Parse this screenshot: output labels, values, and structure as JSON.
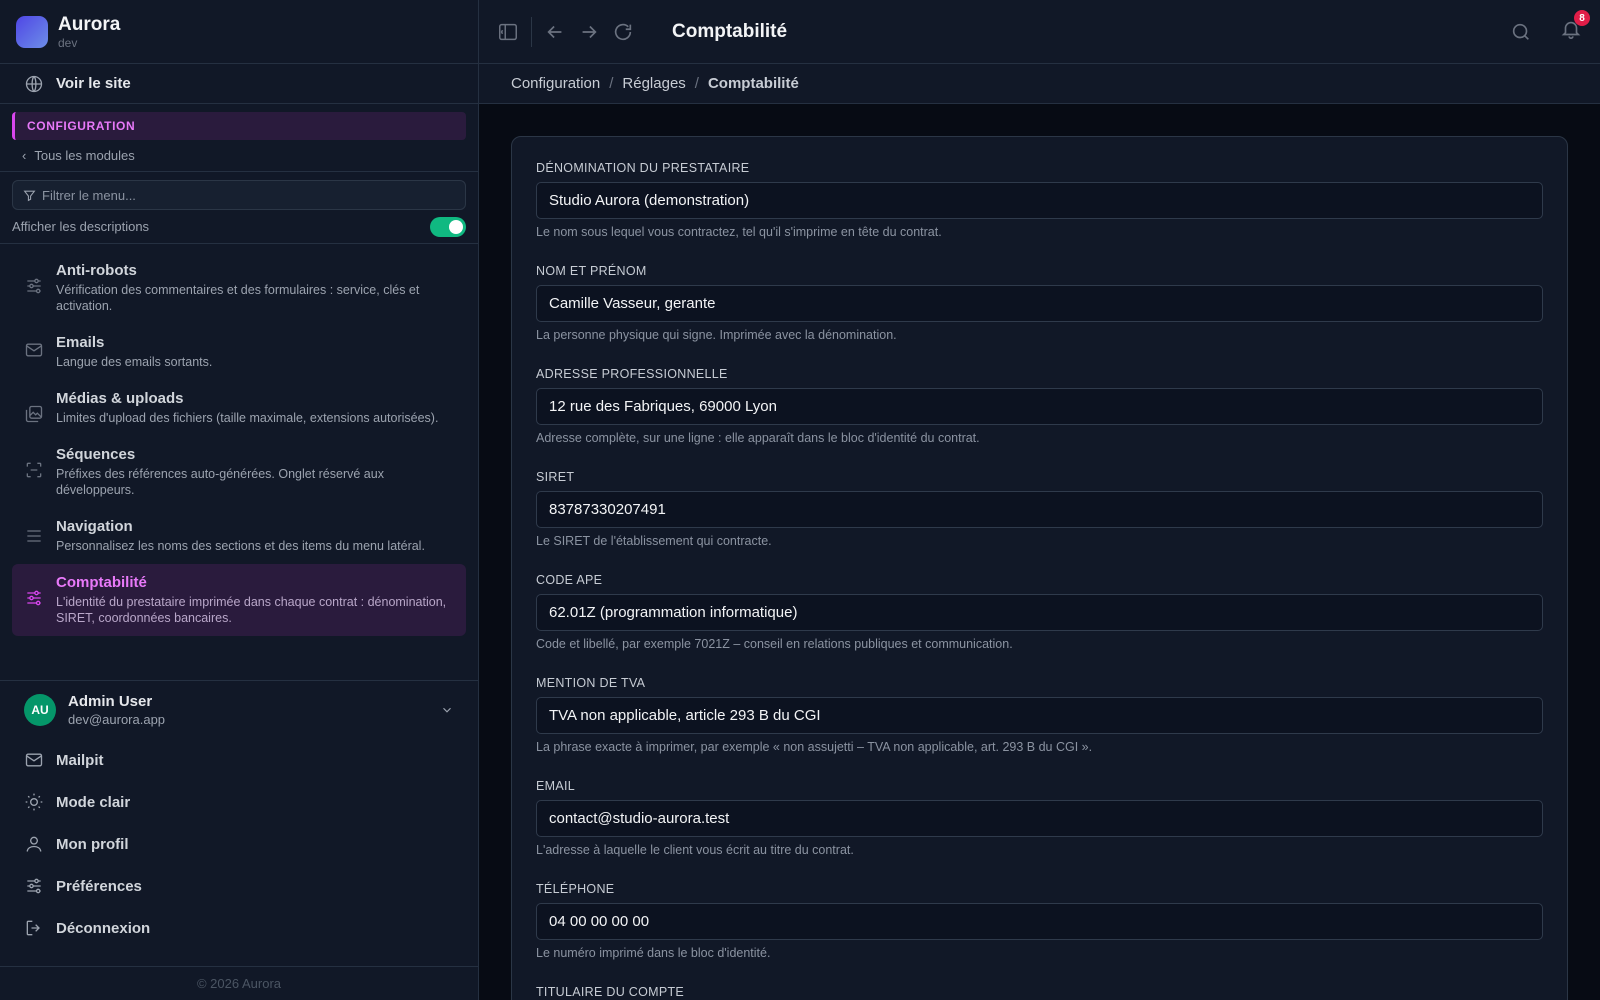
{
  "brand": {
    "name": "Aurora",
    "env": "dev"
  },
  "sidebar": {
    "site_link": "Voir le site",
    "section": "CONFIGURATION",
    "back": "Tous les modules",
    "filter_placeholder": "Filtrer le menu...",
    "toggle_label": "Afficher les descriptions",
    "toggle_on": true,
    "modules": [
      {
        "title": "Anti-robots",
        "desc": "Vérification des commentaires et des formulaires : service, clés et activation.",
        "icon": "sliders-icon"
      },
      {
        "title": "Emails",
        "desc": "Langue des emails sortants.",
        "icon": "mail-icon"
      },
      {
        "title": "Médias & uploads",
        "desc": "Limites d'upload des fichiers (taille maximale, extensions autorisées).",
        "icon": "images-icon"
      },
      {
        "title": "Séquences",
        "desc": "Préfixes des références auto-générées. Onglet réservé aux développeurs.",
        "icon": "scan-icon"
      },
      {
        "title": "Navigation",
        "desc": "Personnalisez les noms des sections et des items du menu latéral.",
        "icon": "list-icon"
      },
      {
        "title": "Comptabilité",
        "desc": "L'identité du prestataire imprimée dans chaque contrat : dénomination, SIRET, coordonnées bancaires.",
        "icon": "sliders-icon",
        "active": true
      }
    ],
    "user": {
      "initials": "AU",
      "name": "Admin User",
      "email": "dev@aurora.app"
    },
    "menu": [
      "Mailpit",
      "Mode clair",
      "Mon profil",
      "Préférences",
      "Déconnexion"
    ],
    "copyright": "© 2026 Aurora"
  },
  "topbar": {
    "title": "Comptabilité",
    "notifications": "8"
  },
  "breadcrumb": [
    "Configuration",
    "Réglages",
    "Comptabilité"
  ],
  "form": {
    "fields": [
      {
        "label": "DÉNOMINATION DU PRESTATAIRE",
        "value": "Studio Aurora (demonstration)",
        "help": "Le nom sous lequel vous contractez, tel qu'il s'imprime en tête du contrat."
      },
      {
        "label": "NOM ET PRÉNOM",
        "value": "Camille Vasseur, gerante",
        "help": "La personne physique qui signe. Imprimée avec la dénomination."
      },
      {
        "label": "ADRESSE PROFESSIONNELLE",
        "value": "12 rue des Fabriques, 69000 Lyon",
        "help": "Adresse complète, sur une ligne : elle apparaît dans le bloc d'identité du contrat."
      },
      {
        "label": "SIRET",
        "value": "83787330207491",
        "help": "Le SIRET de l'établissement qui contracte."
      },
      {
        "label": "CODE APE",
        "value": "62.01Z (programmation informatique)",
        "help": "Code et libellé, par exemple 7021Z – conseil en relations publiques et communication."
      },
      {
        "label": "MENTION DE TVA",
        "value": "TVA non applicable, article 293 B du CGI",
        "help": "La phrase exacte à imprimer, par exemple « non assujetti – TVA non applicable, art. 293 B du CGI »."
      },
      {
        "label": "EMAIL",
        "value": "contact@studio-aurora.test",
        "help": "L'adresse à laquelle le client vous écrit au titre du contrat."
      },
      {
        "label": "TÉLÉPHONE",
        "value": "04 00 00 00 00",
        "help": "Le numéro imprimé dans le bloc d'identité."
      },
      {
        "label": "TITULAIRE DU COMPTE",
        "value": "",
        "help": ""
      }
    ]
  },
  "colors": {
    "accent": "#e879f9",
    "toggle": "#10b981",
    "badge": "#e11d48",
    "avatar": "#059669"
  }
}
